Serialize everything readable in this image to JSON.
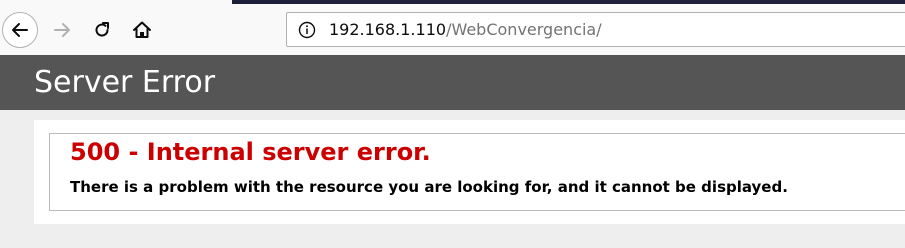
{
  "browser": {
    "url_host": "192.168.1.110",
    "url_path": "/WebConvergencia/",
    "icons": {
      "back": "arrow-left-icon",
      "forward": "arrow-right-icon",
      "reload": "reload-icon",
      "home": "home-icon",
      "site_info": "info-circle-icon"
    }
  },
  "page": {
    "header_title": "Server Error",
    "error_heading": "500 - Internal server error.",
    "error_detail": "There is a problem with the resource you are looking for, and it cannot be displayed."
  },
  "colors": {
    "header_bg": "#555555",
    "error_red": "#cc0000",
    "page_bg": "#eeeeee"
  }
}
